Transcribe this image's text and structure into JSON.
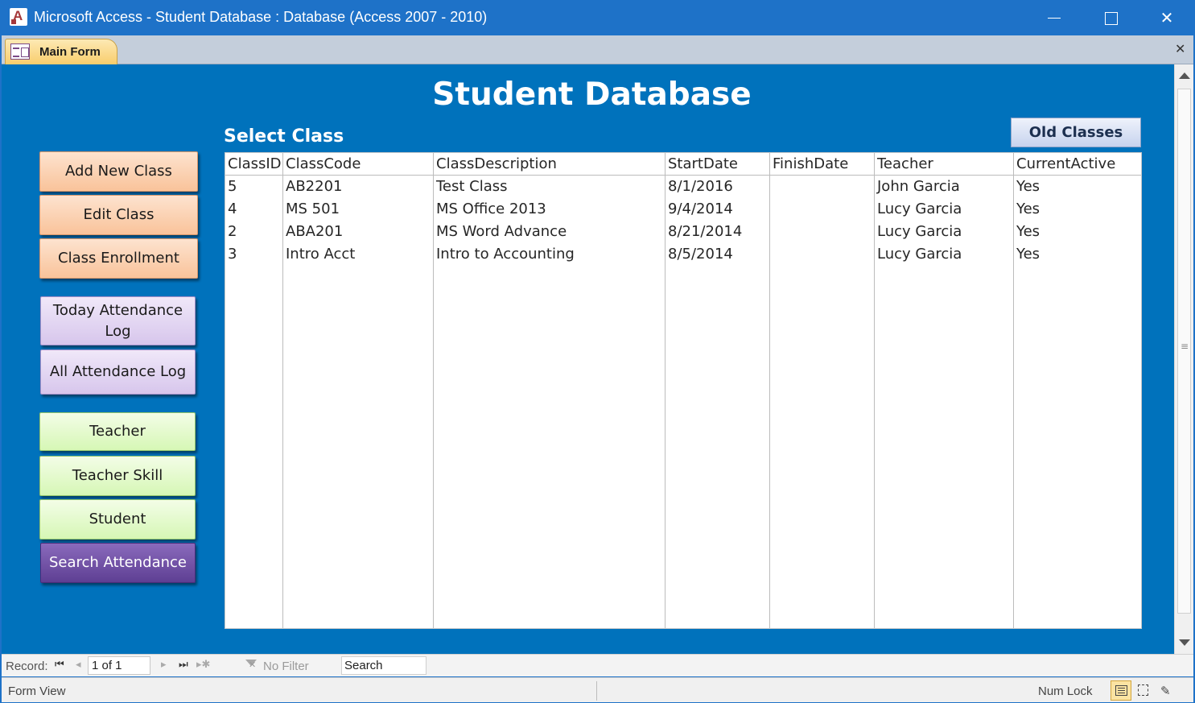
{
  "window": {
    "title": "Microsoft Access - Student Database : Database (Access 2007 - 2010)",
    "close_glyph": "✕"
  },
  "tabs": {
    "active_label": "Main Form",
    "close_glyph": "✕"
  },
  "form": {
    "title": "Student Database",
    "select_label": "Select Class",
    "old_classes_label": "Old Classes",
    "nav_buttons": [
      {
        "label": "Add New Class",
        "color": "#f9c39a"
      },
      {
        "label": "Edit Class",
        "color": "#f9c39a"
      },
      {
        "label": "Class Enrollment",
        "color": "#f9c39a"
      },
      {
        "label": "Today Attendance Log",
        "color": "#d7c6ec"
      },
      {
        "label": "All Attendance Log",
        "color": "#d7c6ec"
      },
      {
        "label": "Teacher",
        "color": "#d6f7b5"
      },
      {
        "label": "Teacher Skill",
        "color": "#d6f7b5"
      },
      {
        "label": "Student",
        "color": "#d6f7b5"
      },
      {
        "label": "Search Attendance",
        "color": "#5e3f93"
      }
    ]
  },
  "datasheet": {
    "columns": [
      "ClassID",
      "ClassCode",
      "ClassDescription",
      "StartDate",
      "FinishDate",
      "Teacher",
      "CurrentActive"
    ],
    "rows": [
      [
        "5",
        "AB2201",
        "Test Class",
        "8/1/2016",
        "",
        "John Garcia",
        "Yes"
      ],
      [
        "4",
        "MS 501",
        "MS Office 2013",
        "9/4/2014",
        "",
        "Lucy Garcia",
        "Yes"
      ],
      [
        "2",
        "ABA201",
        "MS Word Advance",
        "8/21/2014",
        "",
        "Lucy Garcia",
        "Yes"
      ],
      [
        "3",
        "Intro Acct",
        "Intro to Accounting",
        "8/5/2014",
        "",
        "Lucy Garcia",
        "Yes"
      ]
    ]
  },
  "record_nav": {
    "label": "Record:",
    "first_glyph": "⏮",
    "prev_glyph": "◂",
    "next_glyph": "▸",
    "last_glyph": "⏭",
    "new_glyph": "▸✱",
    "position": "1 of 1",
    "filter_label": "No Filter",
    "search_value": "Search"
  },
  "statusbar": {
    "view_name": "Form View",
    "num_lock": "Num Lock"
  },
  "colors": {
    "titlebar": "#1e72c8",
    "form_background": "#0072bc"
  }
}
